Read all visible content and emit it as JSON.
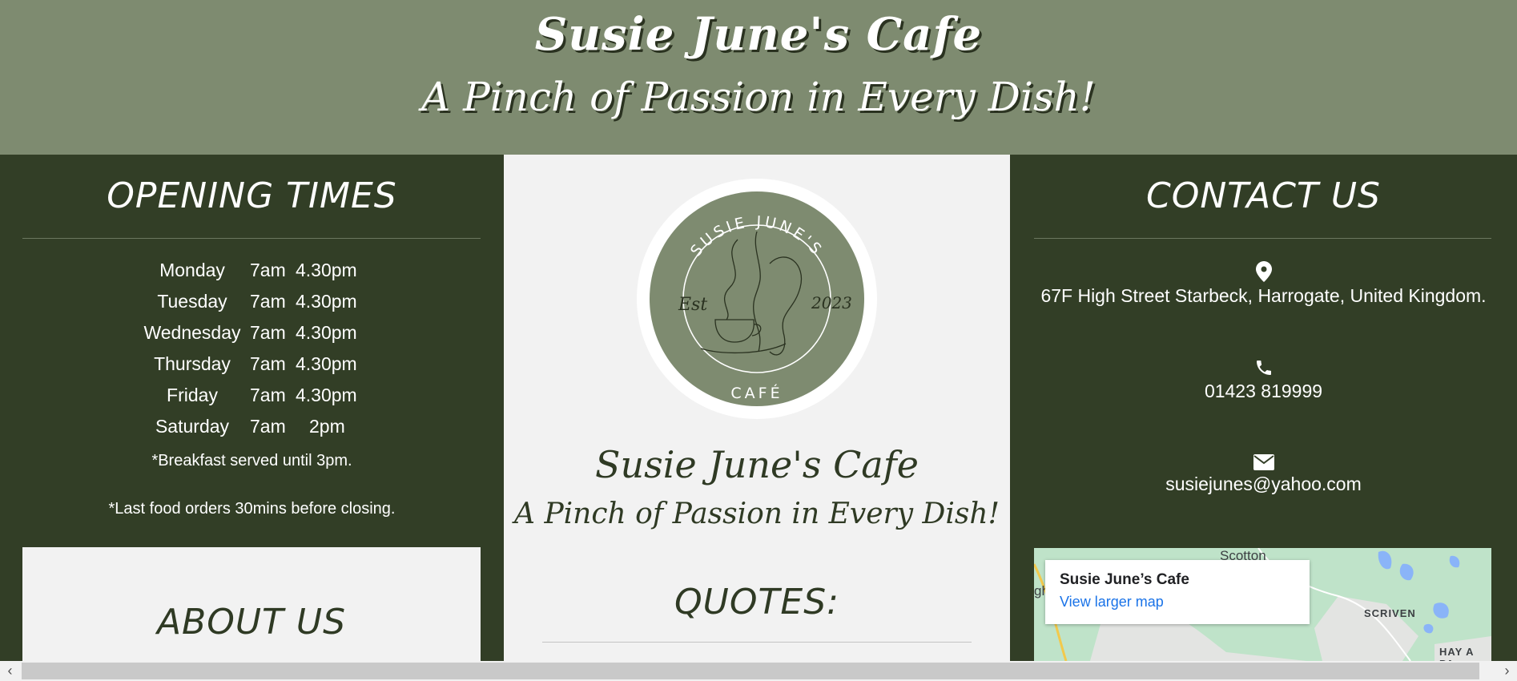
{
  "header": {
    "title": "Susie June's Cafe",
    "tagline": "A Pinch of Passion in Every Dish!"
  },
  "opening": {
    "heading": "OPENING TIMES",
    "rows": [
      {
        "day": "Monday",
        "open": "7am",
        "close": "4.30pm"
      },
      {
        "day": "Tuesday",
        "open": "7am",
        "close": "4.30pm"
      },
      {
        "day": "Wednesday",
        "open": "7am",
        "close": "4.30pm"
      },
      {
        "day": "Thursday",
        "open": "7am",
        "close": "4.30pm"
      },
      {
        "day": "Friday",
        "open": "7am",
        "close": "4.30pm"
      },
      {
        "day": "Saturday",
        "open": "7am",
        "close": "2pm"
      }
    ],
    "note_breakfast": "*Breakfast served until 3pm.",
    "note_last_orders": "*Last food orders 30mins before closing."
  },
  "about": {
    "heading": "ABOUT US"
  },
  "logo": {
    "top_text": "SUSIE JUNE'S",
    "est": "Est",
    "year": "2023",
    "bottom_text": "CAFÉ"
  },
  "middle": {
    "title": "Susie June's Cafe",
    "tagline": "A Pinch of Passion in Every Dish!",
    "quotes_heading": "QUOTES:"
  },
  "contact": {
    "heading": "CONTACT US",
    "address": "67F High Street Starbeck, Harrogate, United Kingdom.",
    "phone": "01423 819999",
    "email": "susiejunes@yahoo.com"
  },
  "map": {
    "place_name": "Susie June’s Cafe",
    "link": "View larger map",
    "label_scotton": "Scotton",
    "label_scriven": "SCRIVEN",
    "label_hay": "HAY A PA",
    "label_edge": "gh"
  },
  "colors": {
    "header_bg": "#7e8b70",
    "dark_green": "#323e26",
    "light_panel": "#f2f2f2"
  },
  "icons": {
    "location": "map-pin-icon",
    "phone": "phone-icon",
    "email": "envelope-icon",
    "scroll_left": "chevron-left-icon",
    "scroll_right": "chevron-right-icon"
  }
}
